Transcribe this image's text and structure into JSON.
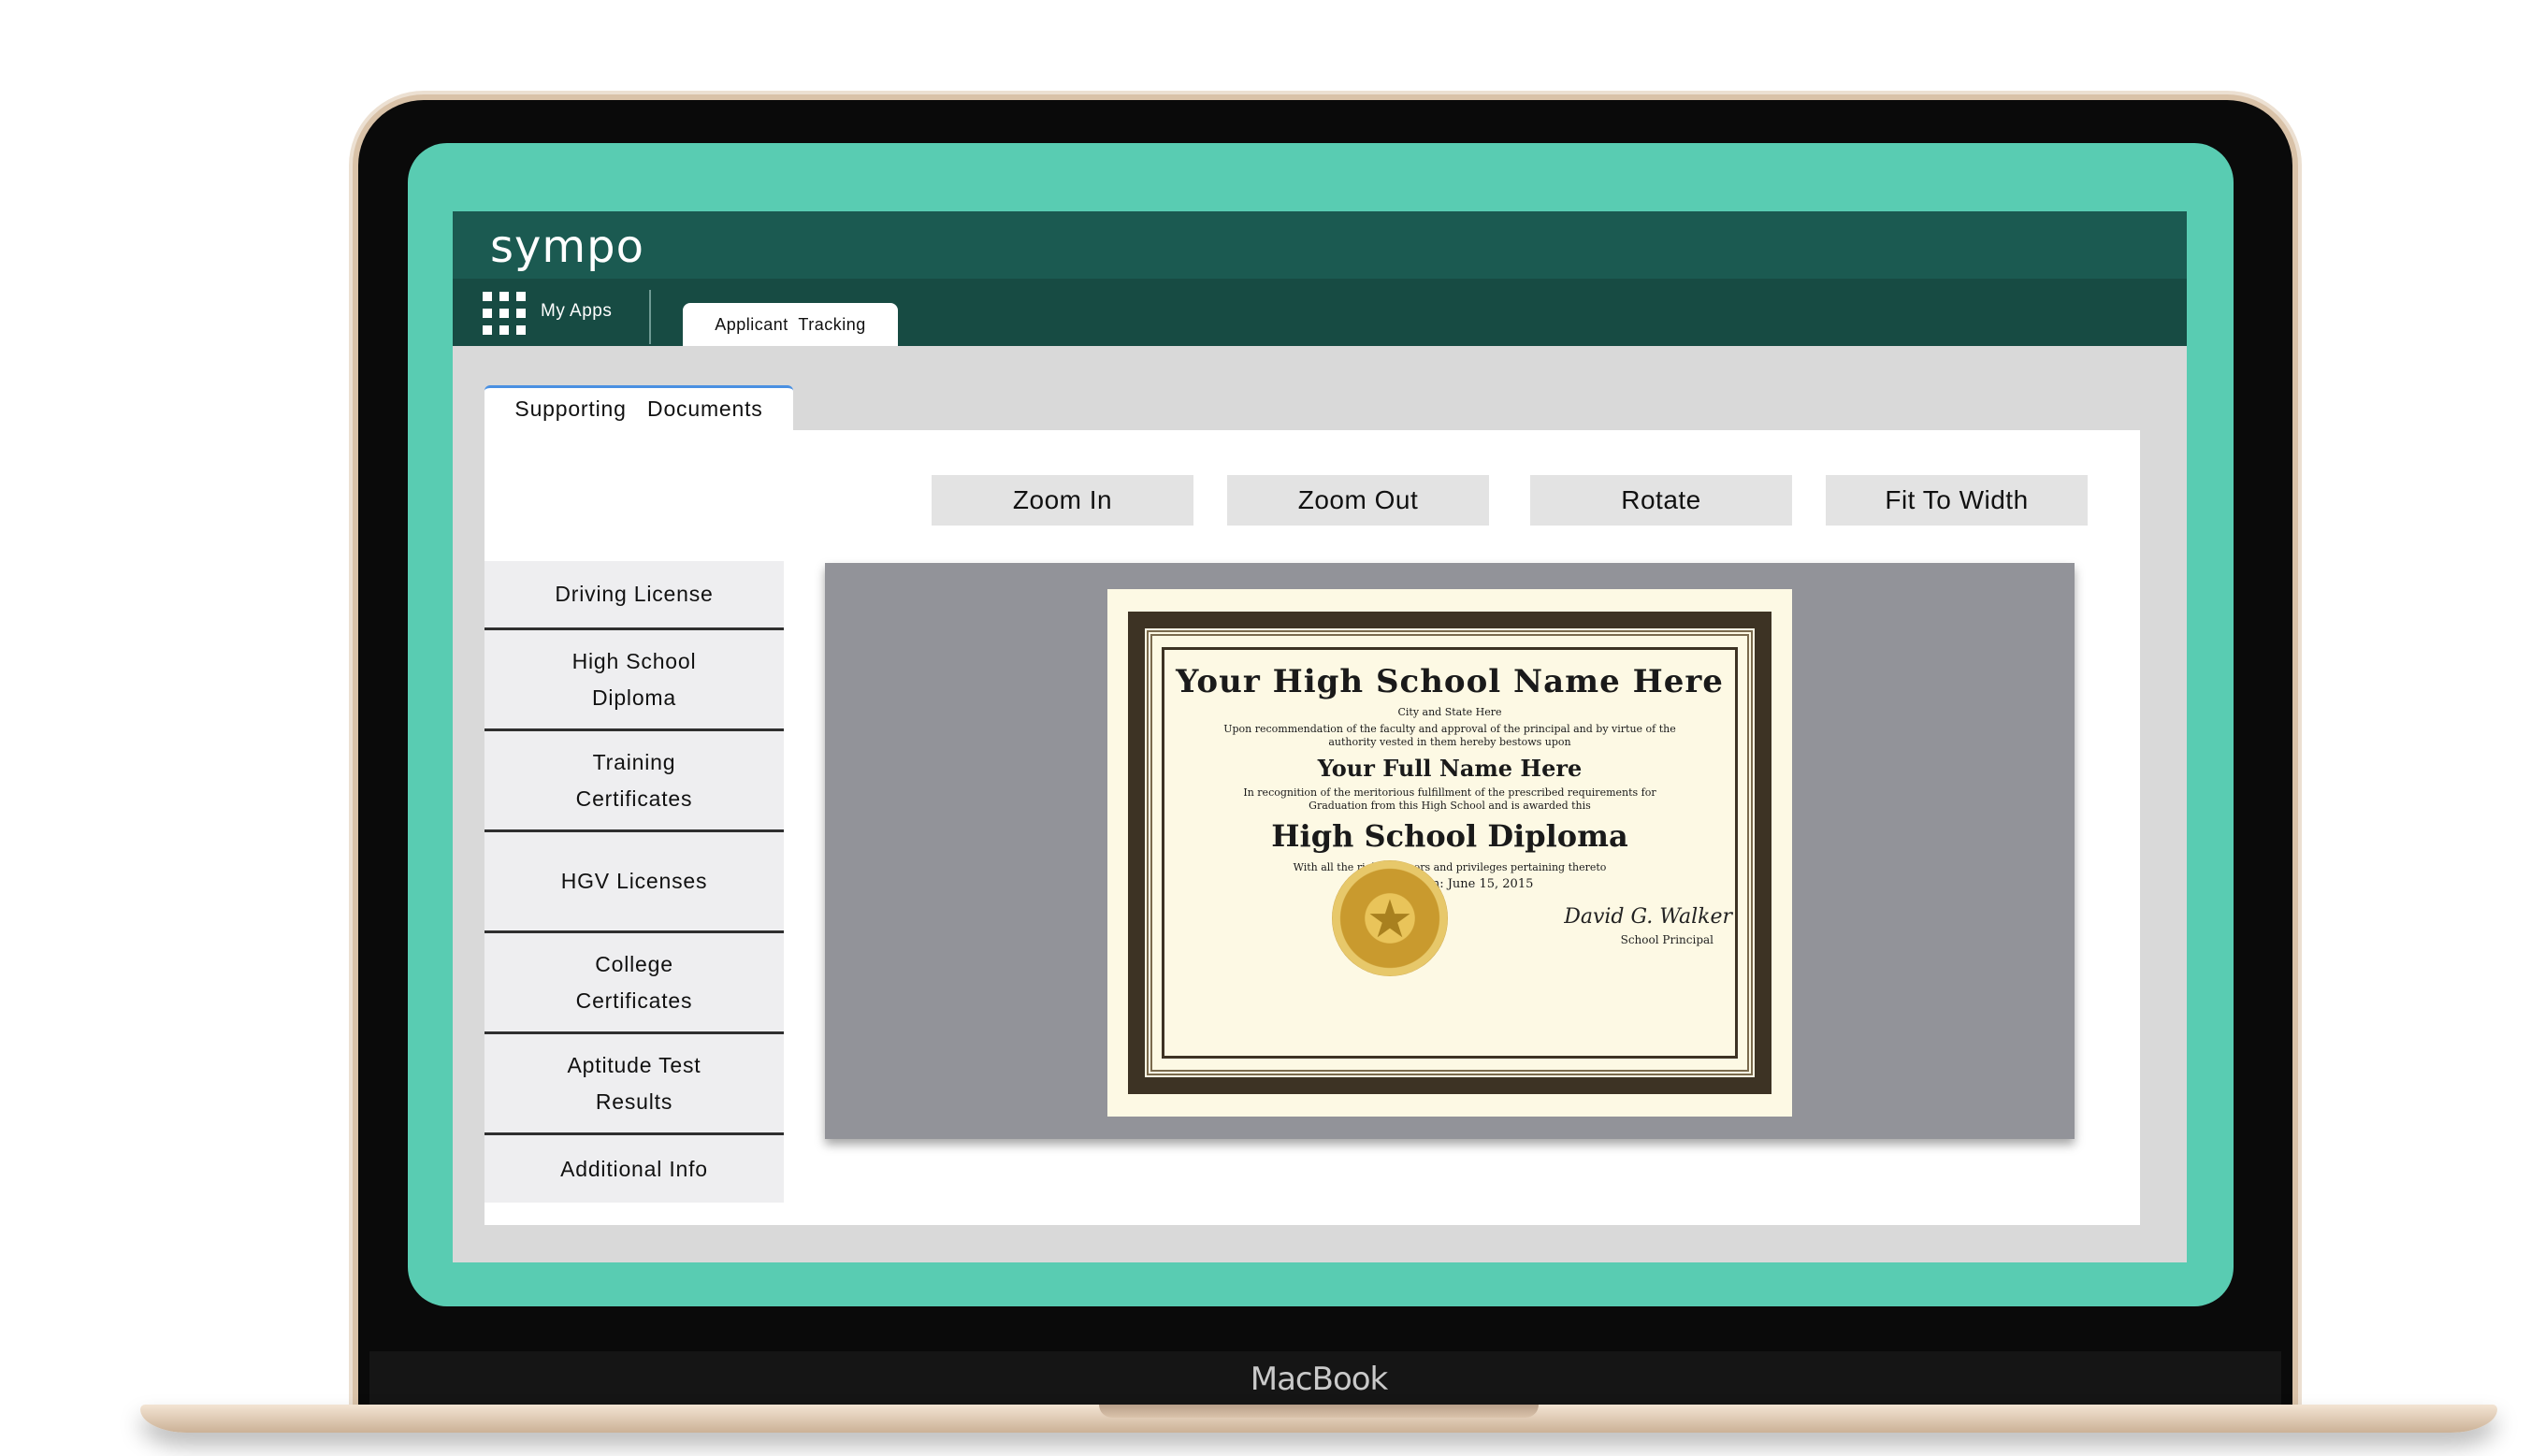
{
  "device": {
    "brand": "MacBook"
  },
  "header": {
    "logo": "sympo"
  },
  "nav": {
    "my_apps": "My Apps",
    "active_tab": "Applicant  Tracking"
  },
  "page": {
    "tab": "Supporting  Documents"
  },
  "toolbar": {
    "zoom_in": "Zoom In",
    "zoom_out": "Zoom Out",
    "rotate": "Rotate",
    "fit_to_width": "Fit To Width"
  },
  "documents": [
    {
      "label": "Driving License"
    },
    {
      "label": "High School\nDiploma"
    },
    {
      "label": "Training\nCertificates"
    },
    {
      "label": "HGV Licenses"
    },
    {
      "label": "College\nCertificates"
    },
    {
      "label": "Aptitude Test\nResults"
    },
    {
      "label": "Additional Info"
    }
  ],
  "diploma": {
    "school_name": "Your High School Name Here",
    "location": "City and State Here",
    "preamble": "Upon recommendation of the faculty and approval of the principal and by virtue of the authority vested in them hereby bestows upon",
    "student_name": "Your Full Name Here",
    "recognition": "In recognition of the meritorious fulfillment of the prescribed requirements for Graduation from this High School and is awarded this",
    "title": "High School Diploma",
    "rights": "With all the rights, honors and privileges pertaining thereto",
    "awarded": "Awarded on: June 15, 2015",
    "signature": "David G. Walker",
    "signer_title": "School Principal"
  },
  "colors": {
    "screen_bg": "#59ccb2",
    "topbar": "#1b5a51",
    "navbar": "#174b43",
    "viewer_bg": "#929399"
  }
}
